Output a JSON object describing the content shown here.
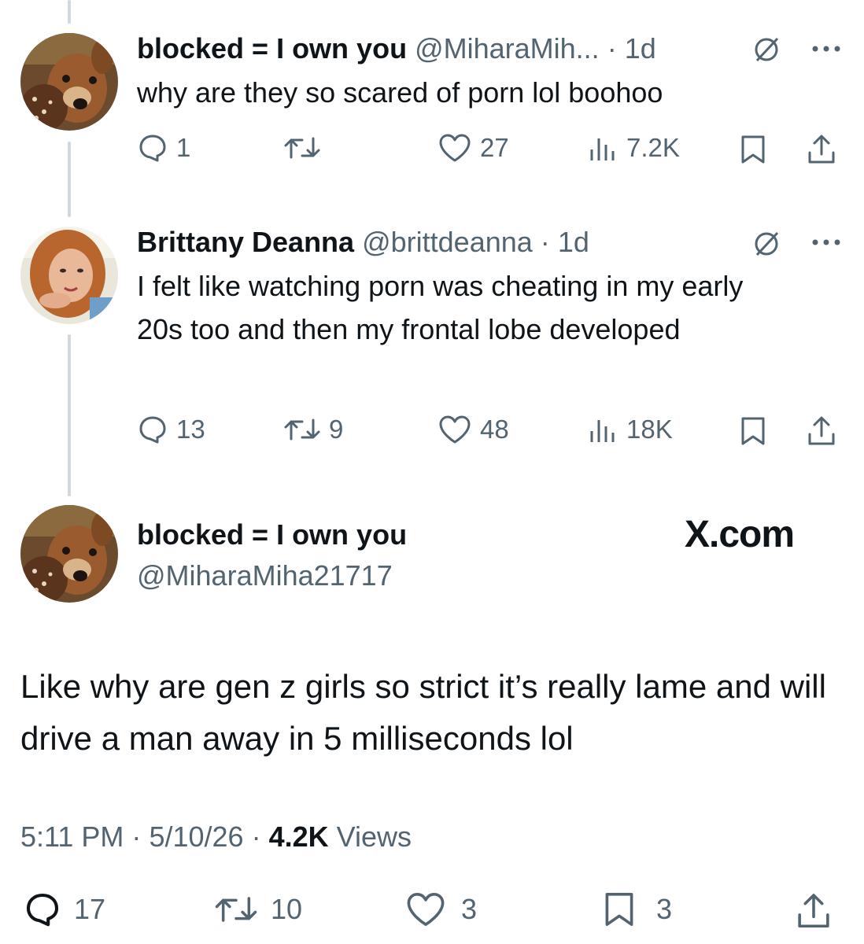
{
  "replies": [
    {
      "name": "blocked = I own you",
      "handle": "@MiharaMih...",
      "time": "1d",
      "text": "why are they so scared of porn lol boohoo",
      "replies": "1",
      "reposts": "",
      "likes": "27",
      "views": "7.2K"
    },
    {
      "name": "Brittany Deanna",
      "handle": "@brittdeanna",
      "time": "1d",
      "text": "I felt like watching porn was cheating in my early 20s too and then my frontal lobe developed",
      "replies": "13",
      "reposts": "9",
      "likes": "48",
      "views": "18K"
    }
  ],
  "main_post": {
    "name": "blocked = I own you",
    "handle": "@MiharaMiha21717",
    "brand": "X.com",
    "text": "Like why are gen z girls so strict it’s really lame and will drive a man away in 5 milliseconds lol",
    "time": "5:11 PM",
    "date": "5/10/26",
    "views_count": "4.2K",
    "views_label": "Views",
    "replies": "17",
    "reposts": "10",
    "likes": "3",
    "bookmarks": "3"
  },
  "separator": "·",
  "icons": {
    "reply": "reply-icon",
    "repost": "repost-icon",
    "like": "like-icon",
    "views": "views-icon",
    "bookmark": "bookmark-icon",
    "share": "share-icon",
    "more": "more-icon",
    "no-entry": "no-entry-icon"
  },
  "colors": {
    "text": "#0f1419",
    "secondary": "#536471",
    "thread_line": "#cfd9de"
  }
}
